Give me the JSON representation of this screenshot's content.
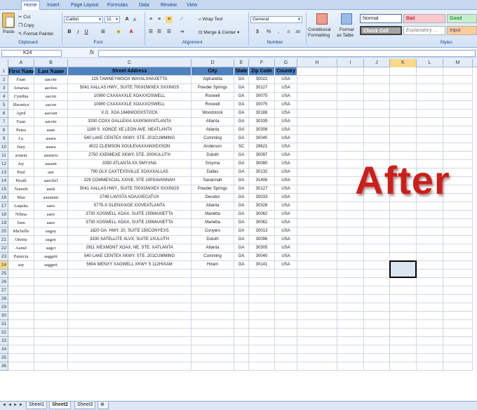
{
  "ribbon": {
    "tabs": [
      "Home",
      "Insert",
      "Page Layout",
      "Formulas",
      "Data",
      "Review",
      "View"
    ],
    "clipboard": {
      "paste": "Paste",
      "cut": "Cut",
      "copy": "Copy",
      "format_painter": "Format Painter",
      "label": "Clipboard"
    },
    "font": {
      "name": "Calibri",
      "size": "11",
      "label": "Font"
    },
    "alignment": {
      "wrap_text": "Wrap Text",
      "merge_center": "Merge & Center",
      "label": "Alignment"
    },
    "number": {
      "format": "General",
      "label": "Number"
    },
    "styles": {
      "conditional_1": "Conditional",
      "conditional_2": "Formatting",
      "format_1": "Format",
      "format_2": "as Table",
      "label": "Styles",
      "normal": "Normal",
      "bad": "Bad",
      "good": "Good",
      "check_cell": "Check Cell",
      "explanatory": "Explanatory ...",
      "input": "Input"
    }
  },
  "formula_bar": {
    "name_box": "K24",
    "fx": "fx",
    "value": ""
  },
  "columns": [
    "A",
    "B",
    "C",
    "D",
    "E",
    "F",
    "G",
    "H",
    "I",
    "J",
    "K",
    "L",
    "M"
  ],
  "table": {
    "headers": [
      "First Name",
      "Last Name",
      "Street Address",
      "City",
      "State",
      "Zip Code",
      "Country"
    ],
    "rows": [
      [
        "Faan",
        "aacote",
        "225 TAWNEYWOOX WAYALXHAXETTA",
        "Alpharetta",
        "GA",
        "30022",
        "USA"
      ],
      [
        "Amanaa",
        "aackus",
        "5041 XALLAS HWY., SUITE 700XOWXEX SXXINGS",
        "Powder Springs",
        "GA",
        "30127",
        "USA"
      ],
      [
        "Cynthia",
        "aacon",
        "10900 CXAXAXXLE XOAXXOSWELL",
        "Roswell",
        "GA",
        "30075",
        "USA"
      ],
      [
        "Sheanice",
        "aacon",
        "10900 CXAXAXXLE XOAXXOSWELL",
        "Roswell",
        "GA",
        "30075",
        "USA"
      ],
      [
        "April",
        "aacoan",
        "X.O. XOA 1846WOOXSTOCK",
        "Woodstock",
        "GA",
        "30188",
        "USA"
      ],
      [
        "Faan",
        "aacote",
        "3200 COXX GALLEXIA XAXKWAYATLANTA",
        "Atlanta",
        "GA",
        "30339",
        "USA"
      ],
      [
        "Petea",
        "aaae",
        "1189 S. XONCE XE LEON AVE. NEATLANTA",
        "Atlanta",
        "GA",
        "30306",
        "USA"
      ],
      [
        "J.a.",
        "aaaea",
        "540 LAKE CENTEX XKWY. STE. 201CUMMING",
        "Cumming",
        "GA",
        "30040",
        "USA"
      ],
      [
        "Juay",
        "aaaea",
        "4022 CLEMSON XOULEVAXXANXEXSON",
        "Anderson",
        "SC",
        "29621",
        "USA"
      ],
      [
        "aoaeat",
        "aaaiacu",
        "2750 XXEMIEXE XKWY, STE. 200XULUTH",
        "Duluth",
        "GA",
        "30097",
        "USA"
      ],
      [
        "Jay",
        "aaaani",
        "3350 ATLANTA XX.SMYXNA",
        "Smyrna",
        "GA",
        "30080",
        "USA"
      ],
      [
        "Paul",
        "aae",
        "790 OLX CAXTEXSVILLE XOAXXALLAS",
        "Dallas",
        "GA",
        "30132",
        "USA"
      ],
      [
        "Heath",
        "aaechel",
        "329 COMMEXCIAL XXIVE, STE 100SAVANNAH",
        "Savannah",
        "GA",
        "31406",
        "USA"
      ],
      [
        "Namoh",
        "aaek",
        "5041 XALLAS HWY., SUITE 700XOWXEX SXXINGS",
        "Powder Springs",
        "GA",
        "30127",
        "USA"
      ],
      [
        "Maa",
        "aaeamm",
        "2749 LAVISTA XOAXXECATUX",
        "Decatur",
        "GA",
        "30033",
        "USA"
      ],
      [
        "Laquita",
        "aaez",
        "5775-X GLENXIXGE XXIVEATLANTA",
        "Atlanta",
        "GA",
        "30328",
        "USA"
      ],
      [
        "Nilma",
        "aaez",
        "3730 XOSWELL XOAX, SUITE 150MAXIETTA",
        "Marietta",
        "GA",
        "30062",
        "USA"
      ],
      [
        "Sam",
        "aaez",
        "3730 XOSWELL XOAX, SUITE 150MAXIETTA",
        "Marietta",
        "GA",
        "30062",
        "USA"
      ],
      [
        "Michelle",
        "aagay",
        "1820 GA. HWY. 20, SUITE 150CONYEXS",
        "Conyers",
        "GA",
        "30013",
        "USA"
      ],
      [
        "Oneita",
        "aagay",
        "3330 SATELLITE XLVX, SUITE 1XULUTH",
        "Duluth",
        "GA",
        "30096",
        "USA"
      ],
      [
        "Aanul",
        "aagci",
        "2911 XIEXMONT XOAX, NE, STE. XATLANTA",
        "Atlanta",
        "GA",
        "30305",
        "USA"
      ],
      [
        "Pataicia",
        "aaggett",
        "540 LAKE CENTEX XKWY. STE. 201CUMMING",
        "Cumming",
        "GA",
        "30040",
        "USA"
      ],
      [
        "aay",
        "aaggett",
        "5604 WENXY XAGWELL XKWY S 112HIXAM",
        "Hiram",
        "GA",
        "30141",
        "USA"
      ]
    ]
  },
  "row_count": 36,
  "selected_cell": {
    "col": "K",
    "row": 24
  },
  "overlay_text": "After",
  "sheets": [
    "Sheet1",
    "Sheet2",
    "Sheet3"
  ],
  "active_sheet": "Sheet2",
  "colors": {
    "header_fill": "#4f81bd",
    "overlay": "#c8201c",
    "selection": "#f8d88c"
  }
}
